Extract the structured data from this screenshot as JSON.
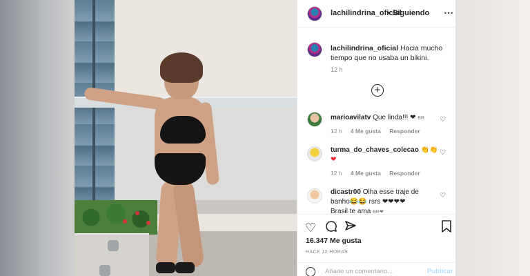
{
  "post": {
    "username": "lachilindrina_oficial",
    "separator": "•",
    "follow_status": "Siguiendo",
    "more_icon": "more-horizontal-icon"
  },
  "caption": {
    "username": "lachilindrina_oficial",
    "text": "Hacia mucho tiempo que no usaba un bikini.",
    "time": "12 h"
  },
  "comments": [
    {
      "username": "marioavilatv",
      "text": "Que linda!!! ❤",
      "suffix": "BR",
      "time": "12 h",
      "likes": "4 Me gusta",
      "reply": "Responder"
    },
    {
      "username": "turma_do_chaves_colecao",
      "text": "👏👏",
      "line2": "❤",
      "time": "12 h",
      "likes": "4 Me gusta",
      "reply": "Responder"
    },
    {
      "username": "dicastr00",
      "text": "Olha esse traje de",
      "line2": "banho😂😂 rsrs ❤❤❤❤",
      "line3": "Brasil te ama",
      "suffix": "BR❤"
    }
  ],
  "actions": {
    "like_icon": "heart-icon",
    "comment_icon": "comment-icon",
    "share_icon": "share-icon",
    "save_icon": "bookmark-icon"
  },
  "likes_count": "16.347 Me gusta",
  "posted_ago": "HACE 12 HORAS",
  "comment_box": {
    "placeholder": "Añade un comentario...",
    "post_label": "Publicar"
  },
  "colors": {
    "text": "#262626",
    "muted": "#8e8e8e",
    "heart": "#ed1f33",
    "post_disabled": "#b2dffc"
  }
}
